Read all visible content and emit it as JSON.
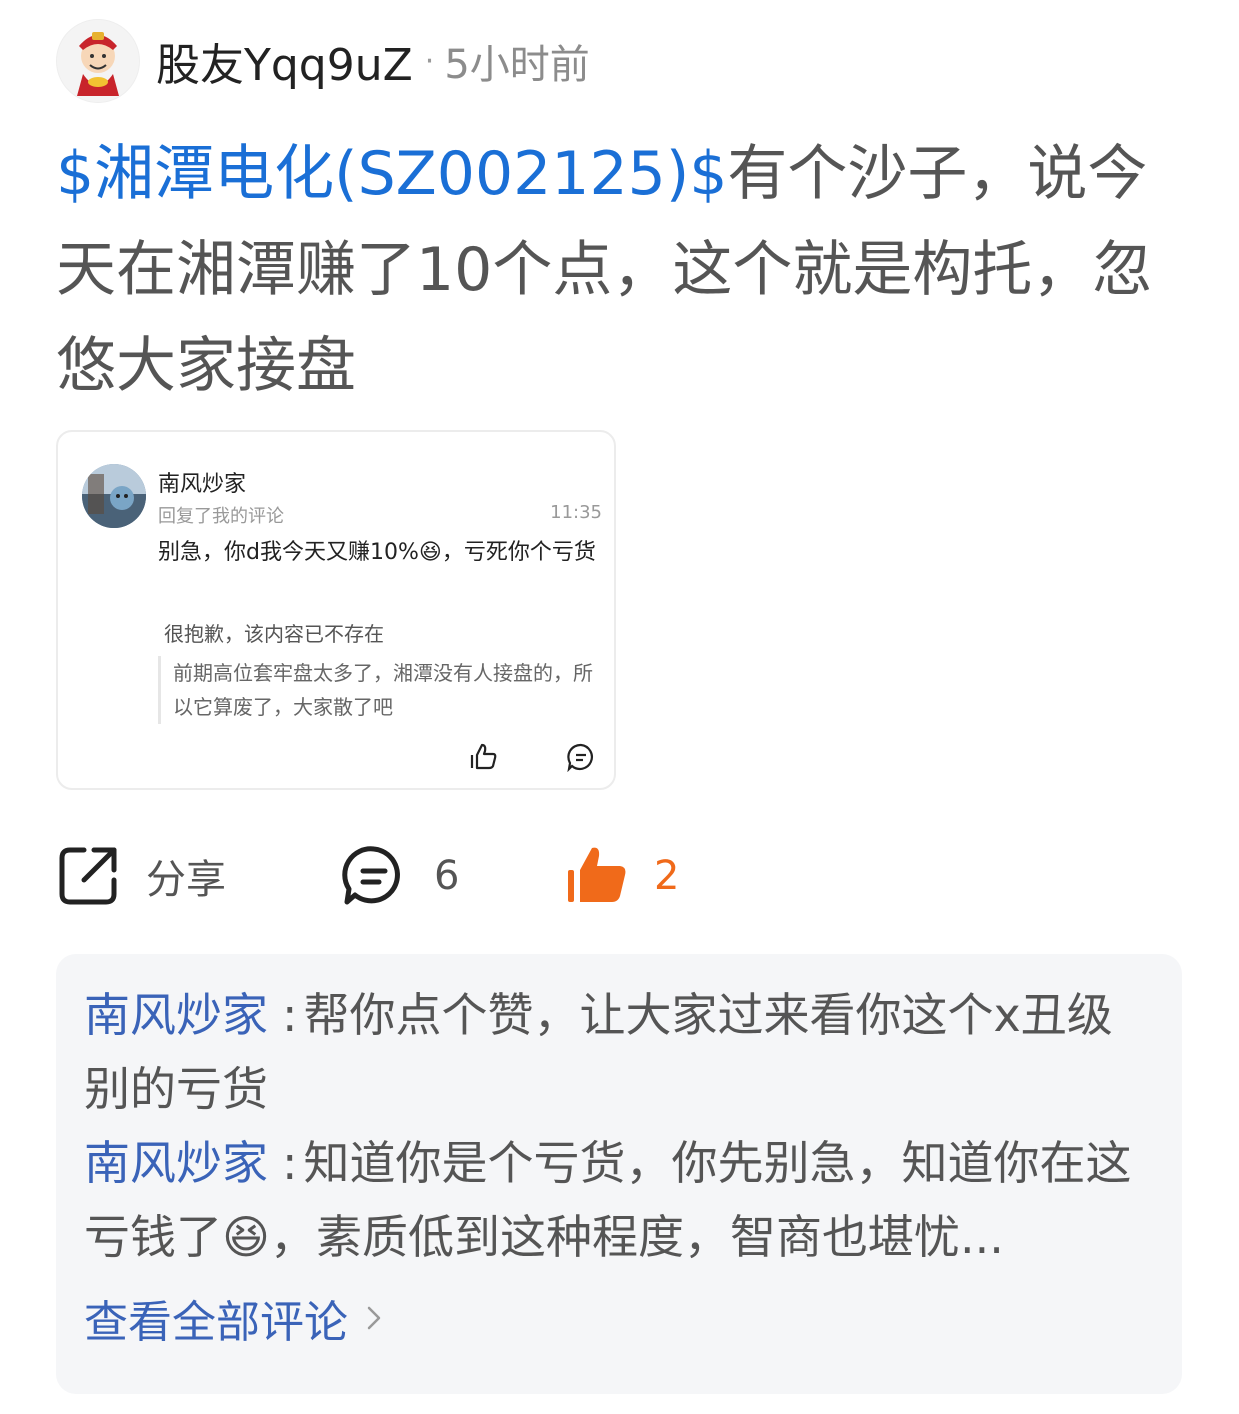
{
  "post": {
    "author": "股友Yqq9uZ",
    "dot": "·",
    "time": "5小时前",
    "stock_tag": "$湘潭电化(SZ002125)$",
    "content": "有个沙子，说今天在湘潭赚了10个点，这个就是构托，忽悠大家接盘"
  },
  "quote_card": {
    "name": "南风炒家",
    "subtitle": "回复了我的评论",
    "time": "11:35",
    "reply": "别急，你d我今天又赚10%",
    "reply_emoji": "😆",
    "reply_tail": "，亏死你个亏货",
    "deleted_notice": "很抱歉，该内容已不存在",
    "quoted_text": "前期高位套牢盘太多了，湘潭没有人接盘的，所以它算废了，大家散了吧"
  },
  "actions": {
    "share_label": "分享",
    "comment_count": "6",
    "like_count": "2"
  },
  "comments": [
    {
      "name": "南风炒家",
      "sep": ":",
      "text": "帮你点个赞，让大家过来看你这个x丑级别的亏货"
    },
    {
      "name": "南风炒家",
      "sep": ":",
      "text_before": "知道你是个亏货，你先别急，知道你在这亏钱了",
      "emoji": "😆",
      "text_after": "，素质低到这种程度，智商也堪忧..."
    }
  ],
  "view_all_label": "查看全部评论",
  "colors": {
    "link_blue": "#1a6fd6",
    "name_blue": "#3a63b8",
    "like_orange": "#f06a1a"
  },
  "icons": [
    "share-icon",
    "comment-icon",
    "thumbs-up-icon",
    "chevron-right-icon"
  ]
}
